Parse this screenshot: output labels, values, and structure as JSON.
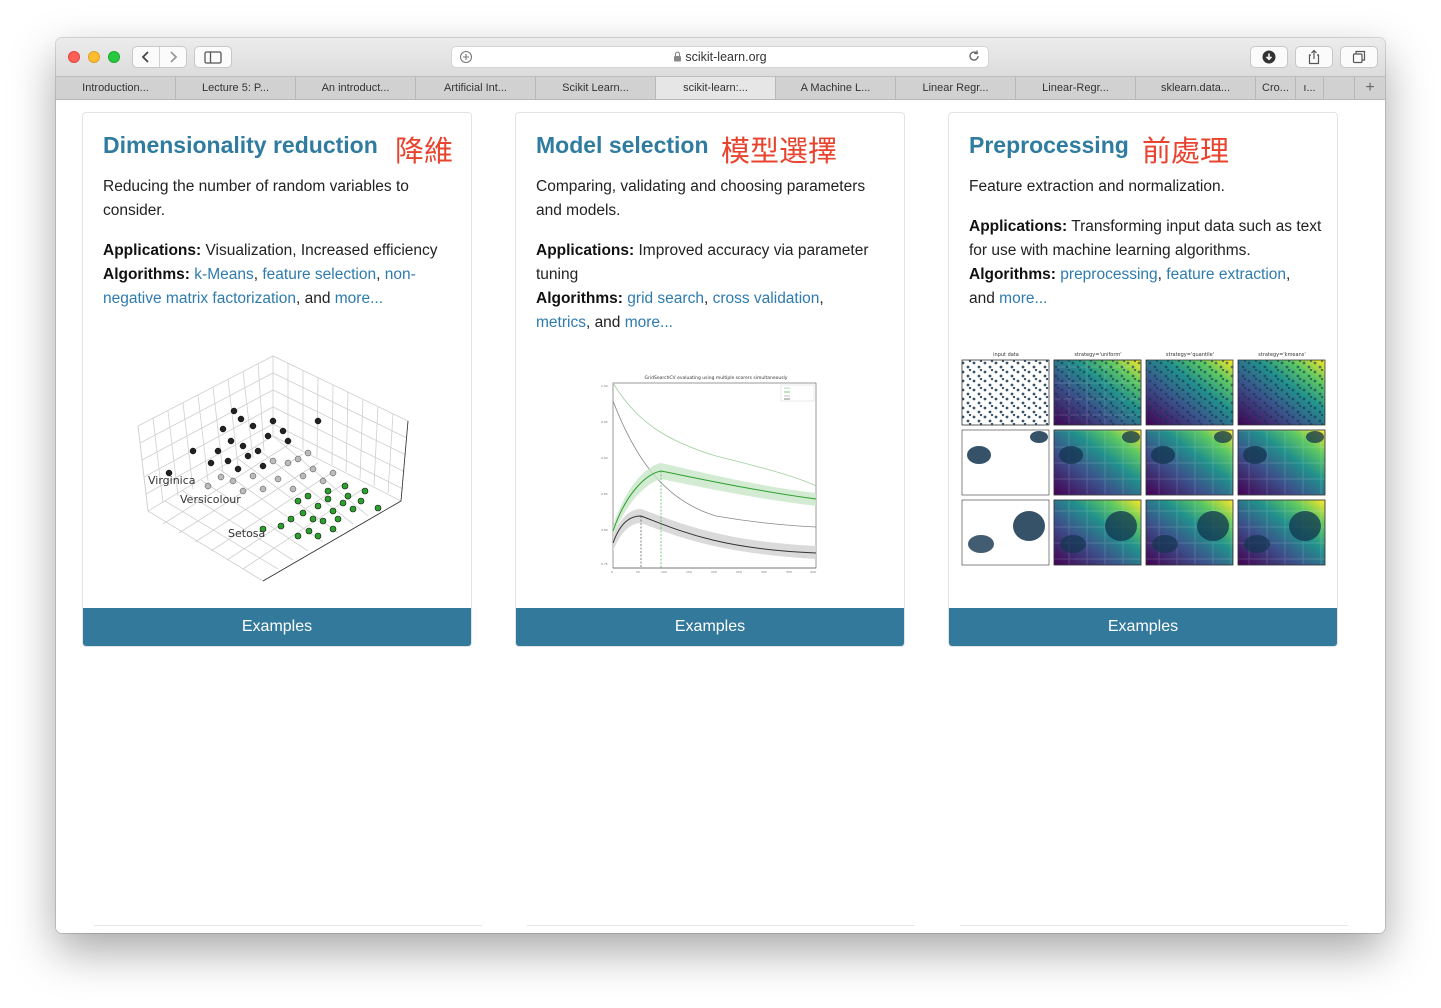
{
  "browser": {
    "url": "scikit-learn.org",
    "tabs": [
      {
        "label": "Introduction..."
      },
      {
        "label": "Lecture 5: P..."
      },
      {
        "label": "An introduct..."
      },
      {
        "label": "Artificial Int..."
      },
      {
        "label": "Scikit Learn..."
      },
      {
        "label": "scikit-learn:..."
      },
      {
        "label": "A Machine L..."
      },
      {
        "label": "Linear Regr..."
      },
      {
        "label": "Linear-Regr..."
      },
      {
        "label": "sklearn.data..."
      },
      {
        "label": "Cro..."
      },
      {
        "label": "ı..."
      }
    ],
    "active_tab": 5
  },
  "cards": [
    {
      "title": "Dimensionality reduction",
      "title_cjk": "降維",
      "description": "Reducing the number of random variables to consider.",
      "applications_label": "Applications:",
      "applications": " Visualization, Increased efficiency",
      "algorithms_label": "Algorithms:",
      "algorithms": [
        "k-Means",
        "feature selection",
        "non-negative matrix factorization"
      ],
      "and_text": ", and ",
      "more": "more...",
      "figure_labels": [
        "Virginica",
        "Versicolour",
        "Setosa"
      ],
      "button": "Examples"
    },
    {
      "title": "Model selection",
      "title_cjk": "模型選擇",
      "description": "Comparing, validating and choosing parameters and models.",
      "applications_label": "Applications:",
      "applications": " Improved accuracy via parameter tuning",
      "algorithms_label": "Algorithms:",
      "algorithms": [
        "grid search",
        "cross validation",
        "metrics"
      ],
      "and_text": ", and ",
      "more": "more...",
      "figure_title": "GridSearchCV evaluating using multiple scorers simultaneously",
      "button": "Examples"
    },
    {
      "title": "Preprocessing",
      "title_cjk": "前處理",
      "description": "Feature extraction and normalization.",
      "applications_label": "Applications:",
      "applications": " Transforming input data such as text for use with machine learning algorithms.",
      "algorithms_label": "Algorithms:",
      "algorithms": [
        "preprocessing",
        "feature extraction"
      ],
      "and_text": ", and ",
      "more": "more...",
      "figure_headers": [
        "input data",
        "strategy='uniform'",
        "strategy='quantile'",
        "strategy='kmeans'"
      ],
      "button": "Examples"
    }
  ],
  "colors": {
    "title_blue": "#2f7ca0",
    "cjk_red": "#e8432e",
    "link": "#2e7bad",
    "button": "#33799b"
  }
}
